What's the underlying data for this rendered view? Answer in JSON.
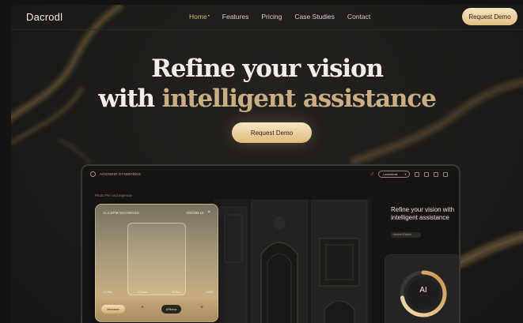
{
  "brand": {
    "logo": "Dacrodl"
  },
  "nav": {
    "items": [
      {
        "label": "Home",
        "active": true
      },
      {
        "label": "Features",
        "active": false
      },
      {
        "label": "Pricing",
        "active": false
      },
      {
        "label": "Case Studies",
        "active": false
      },
      {
        "label": "Contact",
        "active": false
      }
    ],
    "cta": "Request Demo"
  },
  "hero": {
    "line1": "Refine your vision",
    "line2_prefix": "with ",
    "line2_highlight": "intelligent assistance",
    "cta": "Request Demo"
  },
  "device": {
    "title": "AGOGRID DYNMODDS",
    "subtitle": "Photo Per and ingeman",
    "mode_label": "Lanantional",
    "glass_card": {
      "heading": "ALCSPM MAGWASS",
      "date": "ADOOB 10",
      "ticks": [
        "10 Wee",
        "JE Clas",
        "02.3ne",
        "MDBE"
      ],
      "button1": "Meoskaro",
      "button2": "ATBoroa"
    },
    "side_text": "Refine your vision with intelligent assistance",
    "side_tag": "Assinto Eaeion",
    "ai_label": "AI",
    "ai_progress": 0.72
  },
  "colors": {
    "accent_gold": "#d9b77a",
    "highlight_text": "#c9ad84",
    "background": "#1c1b19"
  }
}
